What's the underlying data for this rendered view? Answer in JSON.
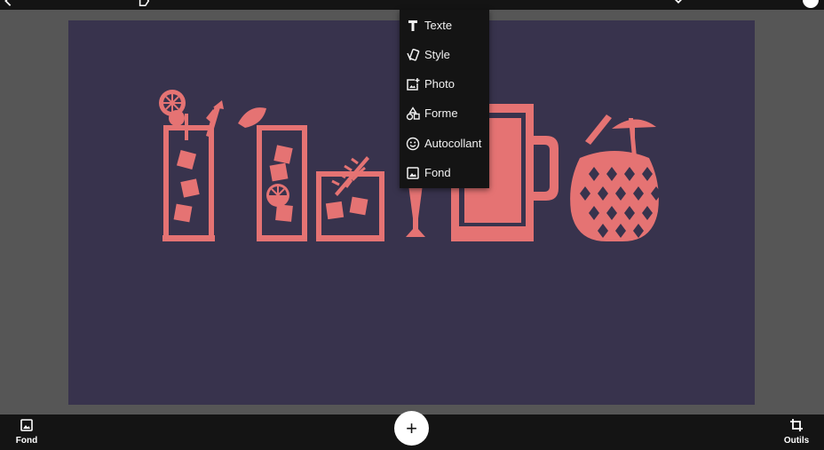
{
  "colors": {
    "workspace": "#565656",
    "canvas_background": "#38334d",
    "artwork": "#e57373",
    "bars": "#141414",
    "menu_text": "#f2f2f2"
  },
  "top_bar": {
    "icons": [
      "back-arrow-icon",
      "label-icon",
      "chevron-down-icon",
      "check-icon"
    ]
  },
  "insert_menu": {
    "items": [
      {
        "icon": "text-icon",
        "label": "Texte"
      },
      {
        "icon": "style-icon",
        "label": "Style"
      },
      {
        "icon": "add-photo-icon",
        "label": "Photo"
      },
      {
        "icon": "shapes-icon",
        "label": "Forme"
      },
      {
        "icon": "sticker-icon",
        "label": "Autocollant"
      },
      {
        "icon": "background-icon",
        "label": "Fond"
      }
    ]
  },
  "bottom_bar": {
    "left_label": "Fond",
    "left_icon": "image-icon",
    "add_symbol": "+",
    "right_label": "Outils",
    "right_icon": "crop-icon"
  }
}
